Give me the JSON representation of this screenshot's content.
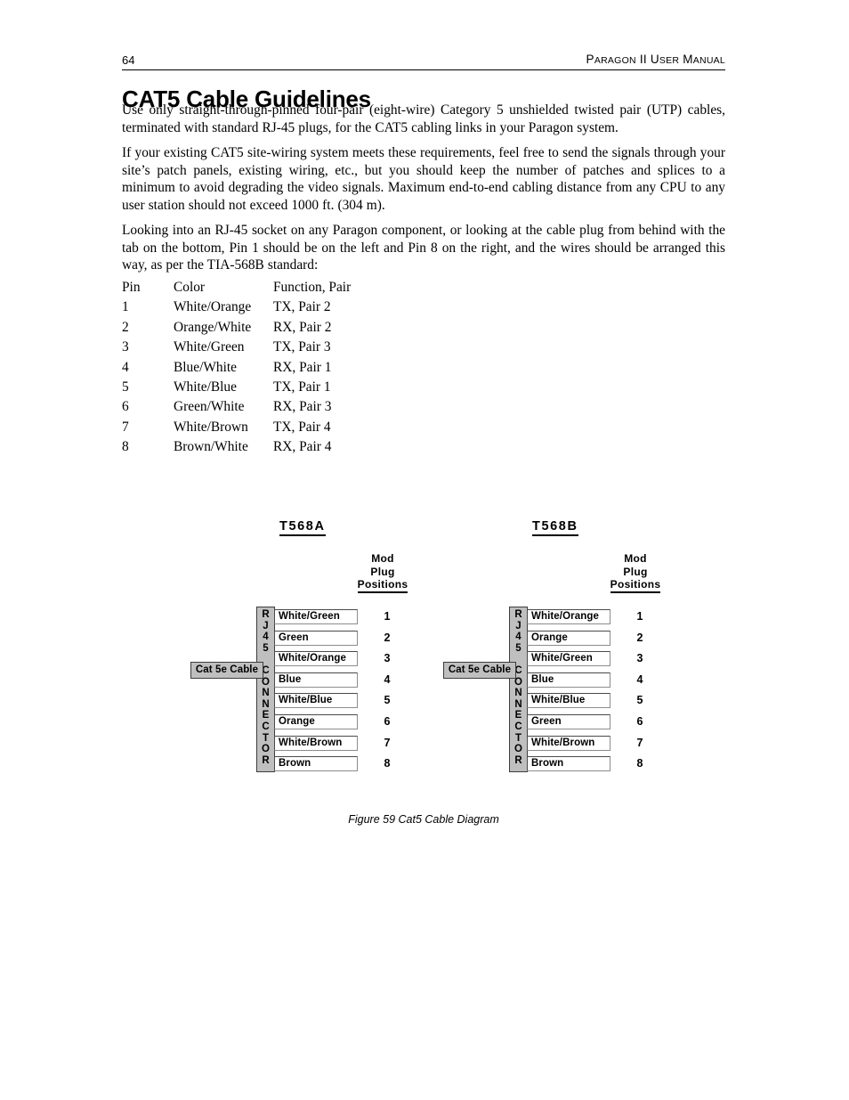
{
  "header": {
    "page_number": "64",
    "running_title": "Paragon II User Manual"
  },
  "chapter_title": "CAT5 Cable Guidelines",
  "paragraphs": [
    "Use only straight-through-pinned four-pair (eight-wire) Category 5 unshielded twisted pair (UTP) cables, terminated with standard RJ-45 plugs, for the CAT5 cabling links in your Paragon system.",
    "If your existing CAT5 site-wiring system meets these requirements, feel free to send the signals through your site’s patch panels, existing wiring, etc., but you should keep the number of patches and splices to a minimum to avoid degrading the video signals. Maximum end-to-end cabling distance from any CPU to any user station should not exceed 1000 ft. (304 m).",
    "Looking into an RJ-45 socket on any Paragon component, or looking at the cable plug from behind with the tab on the bottom, Pin 1 should be on the left and Pin 8 on the right, and the wires should be arranged this way, as per the TIA-568B standard:"
  ],
  "pin_table": {
    "headers": [
      "Pin",
      "Color",
      "Function, Pair"
    ],
    "rows": [
      [
        "1",
        "White/Orange",
        "TX, Pair 2"
      ],
      [
        "2",
        "Orange/White",
        "RX, Pair 2"
      ],
      [
        "3",
        "White/Green",
        "TX, Pair 3"
      ],
      [
        "4",
        "Blue/White",
        "RX, Pair 1"
      ],
      [
        "5",
        "White/Blue",
        "TX, Pair 1"
      ],
      [
        "6",
        "Green/White",
        "RX, Pair 3"
      ],
      [
        "7",
        "White/Brown",
        "TX, Pair 4"
      ],
      [
        "8",
        "Brown/White",
        "RX, Pair 4"
      ]
    ]
  },
  "diagrams": [
    {
      "title": "T568A",
      "mod_plug_label": [
        "Mod",
        "Plug",
        "Positions"
      ],
      "connector_label": "RJ45 CONNECTOR",
      "connector_letters": [
        "R",
        "J",
        "4",
        "5",
        "",
        "C",
        "O",
        "N",
        "N",
        "E",
        "C",
        "T",
        "O",
        "R"
      ],
      "cable_label": "Cat 5e Cable",
      "wires": [
        {
          "position": "1",
          "color": "White/Green"
        },
        {
          "position": "2",
          "color": "Green"
        },
        {
          "position": "3",
          "color": "White/Orange"
        },
        {
          "position": "4",
          "color": "Blue"
        },
        {
          "position": "5",
          "color": "White/Blue"
        },
        {
          "position": "6",
          "color": "Orange"
        },
        {
          "position": "7",
          "color": "White/Brown"
        },
        {
          "position": "8",
          "color": "Brown"
        }
      ]
    },
    {
      "title": "T568B",
      "mod_plug_label": [
        "Mod",
        "Plug",
        "Positions"
      ],
      "connector_label": "RJ45 CONNECTOR",
      "connector_letters": [
        "R",
        "J",
        "4",
        "5",
        "",
        "C",
        "O",
        "N",
        "N",
        "E",
        "C",
        "T",
        "O",
        "R"
      ],
      "cable_label": "Cat 5e Cable",
      "wires": [
        {
          "position": "1",
          "color": "White/Orange"
        },
        {
          "position": "2",
          "color": "Orange"
        },
        {
          "position": "3",
          "color": "White/Green"
        },
        {
          "position": "4",
          "color": "Blue"
        },
        {
          "position": "5",
          "color": "White/Blue"
        },
        {
          "position": "6",
          "color": "Green"
        },
        {
          "position": "7",
          "color": "White/Brown"
        },
        {
          "position": "8",
          "color": "Brown"
        }
      ]
    }
  ],
  "figure_caption": "Figure 59 Cat5 Cable Diagram",
  "colors": {
    "page_background": "#ffffff",
    "text": "#000000",
    "diagram_gray": "#bfbfbf",
    "diagram_border": "#3d3d3d"
  }
}
